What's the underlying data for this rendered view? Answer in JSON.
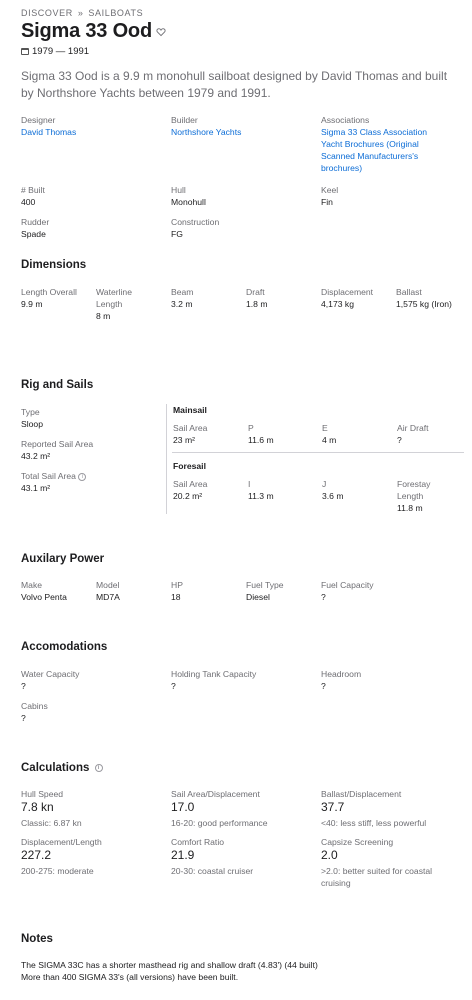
{
  "breadcrumb": {
    "discover": "DISCOVER",
    "sep": "»",
    "sailboats": "SAILBOATS"
  },
  "boat": {
    "title": "Sigma 33 Ood",
    "years": "1979 — 1991"
  },
  "description": "Sigma 33 Ood is a 9.9 m monohull sailboat designed by David Thomas and built by Northshore Yachts between 1979 and 1991.",
  "overview": {
    "designer": {
      "label": "Designer",
      "value": "David Thomas"
    },
    "builder": {
      "label": "Builder",
      "value": "Northshore Yachts"
    },
    "associations": {
      "label": "Associations",
      "links": [
        "Sigma 33 Class Association",
        "Yacht Brochures (Original Scanned Manufacturers's brochures)"
      ]
    },
    "built": {
      "label": "# Built",
      "value": "400"
    },
    "hull": {
      "label": "Hull",
      "value": "Monohull"
    },
    "keel": {
      "label": "Keel",
      "value": "Fin"
    },
    "rudder": {
      "label": "Rudder",
      "value": "Spade"
    },
    "construction": {
      "label": "Construction",
      "value": "FG"
    }
  },
  "dimensions": {
    "heading": "Dimensions",
    "length_overall": {
      "label": "Length Overall",
      "value": "9.9 m"
    },
    "waterline_length": {
      "label": "Waterline Length",
      "value": "8 m"
    },
    "beam": {
      "label": "Beam",
      "value": "3.2 m"
    },
    "draft": {
      "label": "Draft",
      "value": "1.8 m"
    },
    "displacement": {
      "label": "Displacement",
      "value": "4,173 kg"
    },
    "ballast": {
      "label": "Ballast",
      "value": "1,575 kg (Iron)"
    }
  },
  "rig": {
    "heading": "Rig and Sails",
    "type": {
      "label": "Type",
      "value": "Sloop"
    },
    "reported_sail_area": {
      "label": "Reported Sail Area",
      "value": "43.2 m²"
    },
    "total_sail_area": {
      "label": "Total Sail Area",
      "value": "43.1 m²"
    },
    "mainsail": {
      "heading": "Mainsail",
      "sail_area": {
        "label": "Sail Area",
        "value": "23 m²"
      },
      "p": {
        "label": "P",
        "value": "11.6 m"
      },
      "e": {
        "label": "E",
        "value": "4 m"
      },
      "air_draft": {
        "label": "Air Draft",
        "value": "?"
      }
    },
    "foresail": {
      "heading": "Foresail",
      "sail_area": {
        "label": "Sail Area",
        "value": "20.2 m²"
      },
      "i": {
        "label": "I",
        "value": "11.3 m"
      },
      "j": {
        "label": "J",
        "value": "3.6 m"
      },
      "forestay": {
        "label": "Forestay Length",
        "value": "11.8 m"
      }
    }
  },
  "power": {
    "heading": "Auxilary Power",
    "make": {
      "label": "Make",
      "value": "Volvo Penta"
    },
    "model": {
      "label": "Model",
      "value": "MD7A"
    },
    "hp": {
      "label": "HP",
      "value": "18"
    },
    "fuel_type": {
      "label": "Fuel Type",
      "value": "Diesel"
    },
    "fuel_capacity": {
      "label": "Fuel Capacity",
      "value": "?"
    }
  },
  "accom": {
    "heading": "Accomodations",
    "water": {
      "label": "Water Capacity",
      "value": "?"
    },
    "holding": {
      "label": "Holding Tank Capacity",
      "value": "?"
    },
    "headroom": {
      "label": "Headroom",
      "value": "?"
    },
    "cabins": {
      "label": "Cabins",
      "value": "?"
    }
  },
  "calc": {
    "heading": "Calculations",
    "hull_speed": {
      "label": "Hull Speed",
      "value": "7.8 kn",
      "note": "Classic: 6.87 kn"
    },
    "sa_disp": {
      "label": "Sail Area/Displacement",
      "value": "17.0",
      "note": "16-20: good performance"
    },
    "ballast_disp": {
      "label": "Ballast/Displacement",
      "value": "37.7",
      "note": "<40: less stiff, less powerful"
    },
    "disp_len": {
      "label": "Displacement/Length",
      "value": "227.2",
      "note": "200-275: moderate"
    },
    "comfort": {
      "label": "Comfort Ratio",
      "value": "21.9",
      "note": "20-30: coastal cruiser"
    },
    "capsize": {
      "label": "Capsize Screening",
      "value": "2.0",
      "note": ">2.0: better suited for coastal cruising"
    }
  },
  "notes": {
    "heading": "Notes",
    "line1": "The SIGMA 33C has a shorter masthead rig and shallow draft (4.83') (44 built)",
    "line2": "More than 400 SIGMA 33's (all versions) have been built."
  },
  "colors": {
    "link": "#0b6cd6",
    "muted": "#6e6e73",
    "text": "#1d1d1f",
    "rule": "#d2d2d7"
  },
  "icons": {
    "heart": "heart-icon",
    "calendar": "calendar-icon",
    "info": "info-icon"
  }
}
